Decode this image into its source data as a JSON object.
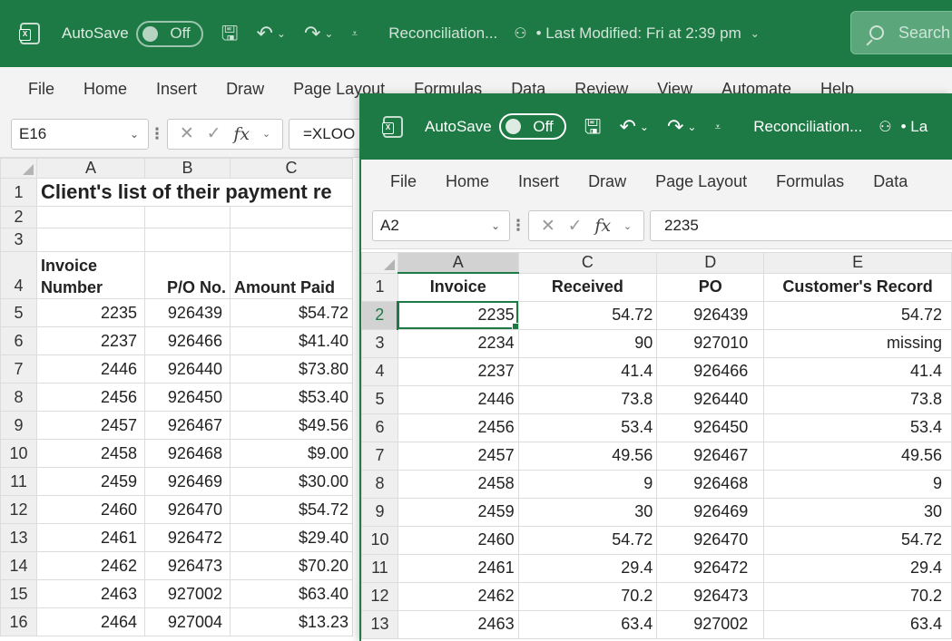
{
  "back_window": {
    "autosave_label": "AutoSave",
    "toggle_label": "Off",
    "doc_title": "Reconciliation...",
    "last_modified": "• Last Modified: Fri at 2:39 pm",
    "search_placeholder": "Search",
    "ribbon_tabs": [
      "File",
      "Home",
      "Insert",
      "Draw",
      "Page Layout",
      "Formulas",
      "Data",
      "Review",
      "View",
      "Automate",
      "Help"
    ],
    "name_box": "E16",
    "formula": "=XLOO",
    "columns": [
      "A",
      "B",
      "C"
    ],
    "title_text": "Client's list of their payment re",
    "header_row": {
      "a": "Invoice Number",
      "b": "P/O No.",
      "c": "Amount Paid"
    },
    "rows": [
      {
        "n": "5",
        "a": "2235",
        "b": "926439",
        "c": "$54.72"
      },
      {
        "n": "6",
        "a": "2237",
        "b": "926466",
        "c": "$41.40"
      },
      {
        "n": "7",
        "a": "2446",
        "b": "926440",
        "c": "$73.80"
      },
      {
        "n": "8",
        "a": "2456",
        "b": "926450",
        "c": "$53.40"
      },
      {
        "n": "9",
        "a": "2457",
        "b": "926467",
        "c": "$49.56"
      },
      {
        "n": "10",
        "a": "2458",
        "b": "926468",
        "c": "$9.00"
      },
      {
        "n": "11",
        "a": "2459",
        "b": "926469",
        "c": "$30.00"
      },
      {
        "n": "12",
        "a": "2460",
        "b": "926470",
        "c": "$54.72"
      },
      {
        "n": "13",
        "a": "2461",
        "b": "926472",
        "c": "$29.40"
      },
      {
        "n": "14",
        "a": "2462",
        "b": "926473",
        "c": "$70.20"
      },
      {
        "n": "15",
        "a": "2463",
        "b": "927002",
        "c": "$63.40"
      },
      {
        "n": "16",
        "a": "2464",
        "b": "927004",
        "c": "$13.23"
      }
    ]
  },
  "front_window": {
    "autosave_label": "AutoSave",
    "toggle_label": "Off",
    "doc_title": "Reconciliation...",
    "last_modified_partial": "• La",
    "ribbon_tabs": [
      "File",
      "Home",
      "Insert",
      "Draw",
      "Page Layout",
      "Formulas",
      "Data"
    ],
    "name_box": "A2",
    "formula": "2235",
    "columns": [
      "A",
      "C",
      "D",
      "E"
    ],
    "header_row": {
      "a": "Invoice",
      "c": "Received",
      "d": "PO",
      "e": "Customer's Record"
    },
    "rows": [
      {
        "n": "2",
        "a": "2235",
        "c": "54.72",
        "d": "926439",
        "e": "54.72"
      },
      {
        "n": "3",
        "a": "2234",
        "c": "90",
        "d": "927010",
        "e": "missing"
      },
      {
        "n": "4",
        "a": "2237",
        "c": "41.4",
        "d": "926466",
        "e": "41.4"
      },
      {
        "n": "5",
        "a": "2446",
        "c": "73.8",
        "d": "926440",
        "e": "73.8"
      },
      {
        "n": "6",
        "a": "2456",
        "c": "53.4",
        "d": "926450",
        "e": "53.4"
      },
      {
        "n": "7",
        "a": "2457",
        "c": "49.56",
        "d": "926467",
        "e": "49.56"
      },
      {
        "n": "8",
        "a": "2458",
        "c": "9",
        "d": "926468",
        "e": "9"
      },
      {
        "n": "9",
        "a": "2459",
        "c": "30",
        "d": "926469",
        "e": "30"
      },
      {
        "n": "10",
        "a": "2460",
        "c": "54.72",
        "d": "926470",
        "e": "54.72"
      },
      {
        "n": "11",
        "a": "2461",
        "c": "29.4",
        "d": "926472",
        "e": "29.4"
      },
      {
        "n": "12",
        "a": "2462",
        "c": "70.2",
        "d": "926473",
        "e": "70.2"
      },
      {
        "n": "13",
        "a": "2463",
        "c": "63.4",
        "d": "927002",
        "e": "63.4"
      }
    ]
  },
  "theme": {
    "accent": "#1e7a45",
    "ribbon_bg": "#f3f3f3",
    "header_bg": "#efefef"
  },
  "icons": [
    "excel-icon",
    "save-icon",
    "undo-icon",
    "redo-icon",
    "customize-icon",
    "share-icon",
    "search-icon",
    "cancel-icon",
    "enter-icon",
    "function-icon"
  ]
}
